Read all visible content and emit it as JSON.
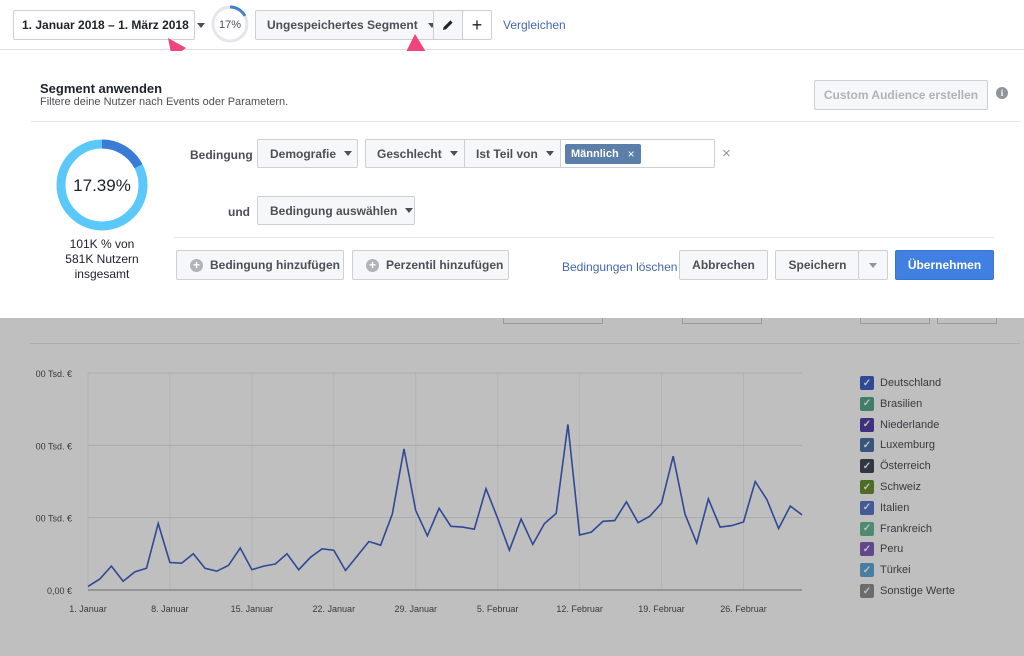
{
  "topbar": {
    "date_range": "1. Januar 2018 – 1. März 2018",
    "progress_label": "17%",
    "progress_fraction": 0.17,
    "segment_label": "Ungespeichertes Segment",
    "compare_label": "Vergleichen"
  },
  "panel": {
    "title": "Segment anwenden",
    "subtitle": "Filtere deine Nutzer nach Events oder Parametern.",
    "custom_audience_label": "Custom Audience erstellen",
    "donut_label": "17.39%",
    "donut_fraction": 0.1739,
    "summary_line1": "101K % von",
    "summary_line2": "581K Nutzern",
    "summary_line3": "insgesamt",
    "condition_label": "Bedingung",
    "condition_type": "Demografie",
    "condition_field": "Geschlecht",
    "condition_operator": "Ist Teil von",
    "condition_value": "Männlich",
    "and_label": "und",
    "select_condition": "Bedingung auswählen",
    "add_condition": "Bedingung hinzufügen",
    "add_percentile": "Perzentil hinzufügen",
    "clear_conditions": "Bedingungen löschen",
    "cancel": "Abbrechen",
    "save": "Speichern",
    "apply": "Übernehmen",
    "accent": "#4080d0",
    "primary": "#4080ff"
  },
  "chart_data": {
    "type": "line",
    "y_tick_labels": [
      "00 Tsd. €",
      "00 Tsd. €",
      "00 Tsd. €",
      "0,00 €"
    ],
    "x_tick_labels": [
      "1. Januar",
      "8. Januar",
      "15. Januar",
      "22. Januar",
      "29. Januar",
      "5. Februar",
      "12. Februar",
      "19. Februar",
      "26. Februar"
    ],
    "ylim": [
      0,
      3
    ],
    "grid": true,
    "legend_position": "right",
    "series": [
      {
        "name": "Deutschland",
        "color": "#4060c8",
        "values": [
          0.05,
          0.15,
          0.33,
          0.12,
          0.25,
          0.3,
          0.92,
          0.38,
          0.37,
          0.5,
          0.3,
          0.26,
          0.34,
          0.58,
          0.28,
          0.33,
          0.36,
          0.5,
          0.28,
          0.45,
          0.57,
          0.55,
          0.27,
          0.47,
          0.67,
          0.62,
          1.05,
          1.95,
          1.1,
          0.75,
          1.13,
          0.88,
          0.87,
          0.84,
          1.4,
          0.99,
          0.55,
          0.98,
          0.63,
          0.92,
          1.06,
          2.29,
          0.76,
          0.8,
          0.95,
          0.96,
          1.22,
          0.93,
          1.02,
          1.2,
          1.85,
          1.05,
          0.65,
          1.26,
          0.87,
          0.89,
          0.94,
          1.5,
          1.25,
          0.85,
          1.16,
          1.04
        ]
      },
      {
        "name": "Brasilien",
        "color": "#57a88a",
        "values": []
      },
      {
        "name": "Niederlande",
        "color": "#5540a8",
        "values": []
      },
      {
        "name": "Luxemburg",
        "color": "#4870a8",
        "values": []
      },
      {
        "name": "Österreich",
        "color": "#404858",
        "values": []
      },
      {
        "name": "Schweiz",
        "color": "#6a9030",
        "values": []
      },
      {
        "name": "Italien",
        "color": "#5a78c8",
        "values": []
      },
      {
        "name": "Frankreich",
        "color": "#6ab898",
        "values": []
      },
      {
        "name": "Peru",
        "color": "#8060b8",
        "values": []
      },
      {
        "name": "Türkei",
        "color": "#60a8d8",
        "values": []
      },
      {
        "name": "Sonstige Werte",
        "color": "#909090",
        "values": []
      }
    ]
  }
}
